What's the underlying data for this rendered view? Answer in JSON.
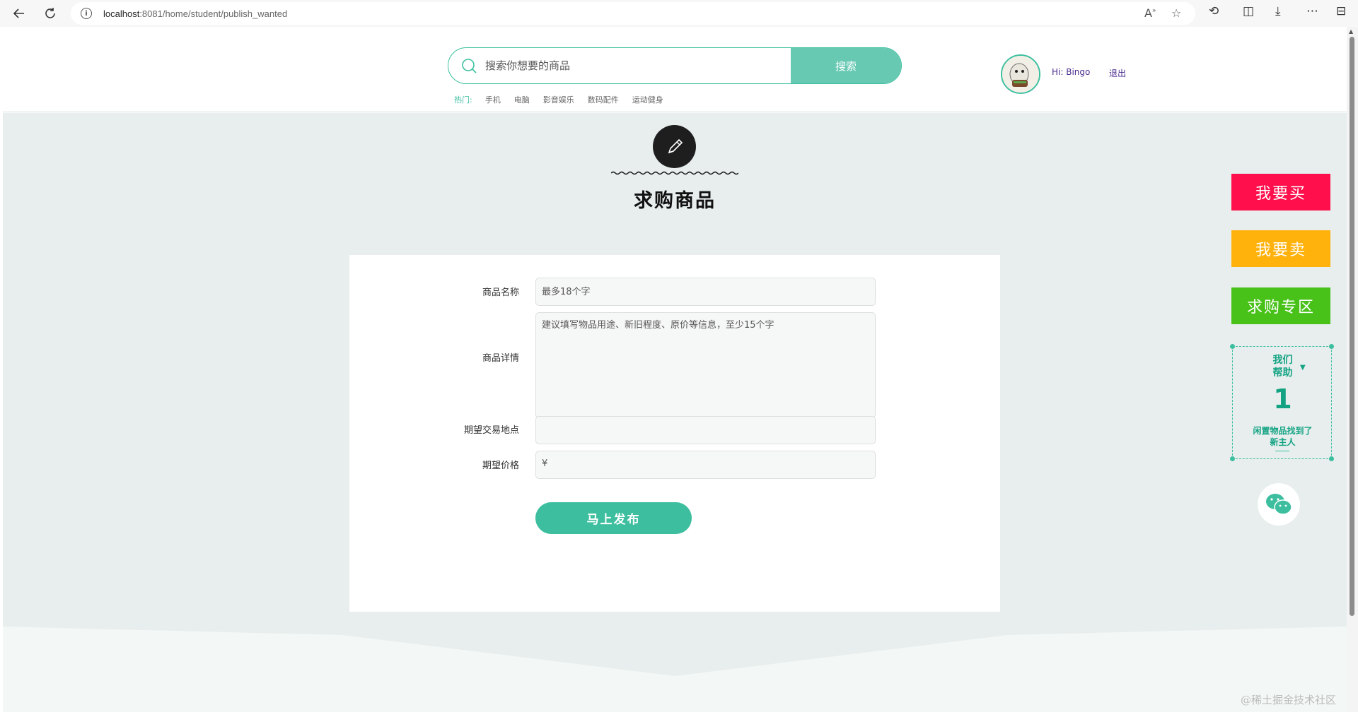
{
  "browser": {
    "url_host": "localhost",
    "url_rest": ":8081/home/student/publish_wanted"
  },
  "header": {
    "search_placeholder": "搜索你想要的商品",
    "search_button": "搜索",
    "hot_label": "热门:",
    "hot_items": [
      "手机",
      "电脑",
      "影音娱乐",
      "数码配件",
      "运动健身"
    ],
    "greeting": "Hi:  Bingo",
    "logout": "退出"
  },
  "main": {
    "title": "求购商品",
    "form": {
      "name_label": "商品名称",
      "name_placeholder": "最多18个字",
      "detail_label": "商品详情",
      "detail_placeholder": "建议填写物品用途、新旧程度、原价等信息，至少15个字",
      "location_label": "期望交易地点",
      "location_value": "",
      "price_label": "期望价格",
      "price_prefix": "¥",
      "submit_button": "马上发布"
    }
  },
  "side_nav": {
    "buy": "我要买",
    "sell": "我要卖",
    "wanted": "求购专区",
    "help_line1": "我们",
    "help_line2": "帮助",
    "help_count": "1",
    "help_text1": "闲置物品找到了",
    "help_text2": "新主人"
  },
  "colors": {
    "accent": "#3dbf9f",
    "buy": "#ff0f4b",
    "sell": "#ffb20c",
    "wanted": "#48c219"
  },
  "watermark": "@稀土掘金技术社区"
}
